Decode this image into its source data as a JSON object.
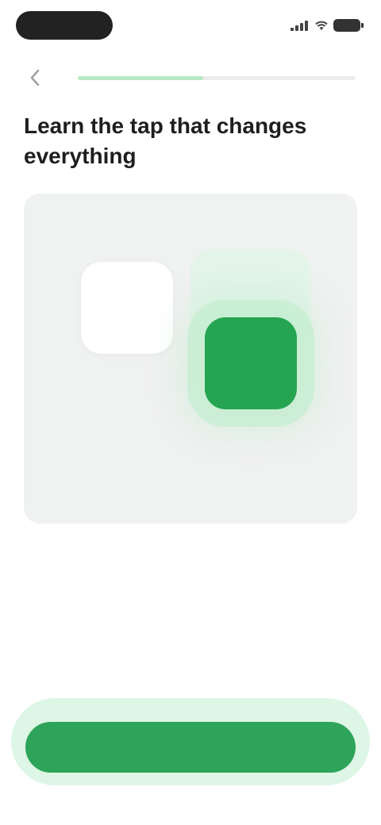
{
  "header": {
    "back_icon": "chevron-left-icon",
    "progress": 0.45
  },
  "title": "Learn the tap that changes everything",
  "illustration": {
    "left_tile": {
      "caption_top": "",
      "caption_bottom": ""
    },
    "right_tile": {
      "caption": ""
    }
  },
  "description": "",
  "primary_button": {
    "label": ""
  },
  "colors": {
    "accent": "#2ea45b",
    "accent_soft": "#b9e8c6",
    "card_bg": "#f0f1f1"
  }
}
